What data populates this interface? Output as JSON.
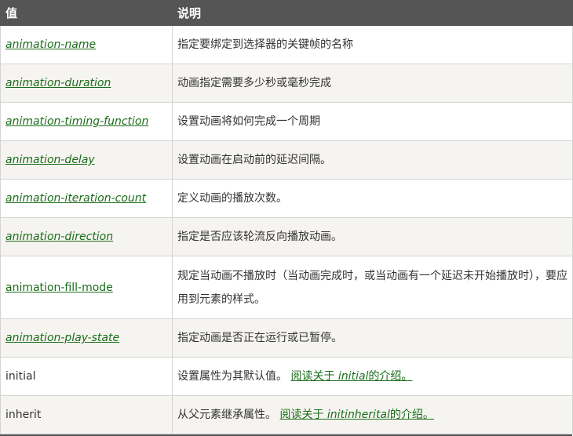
{
  "table": {
    "headers": [
      "值",
      "说明"
    ],
    "rows": [
      {
        "value": "animation-name",
        "link": true,
        "desc": "指定要绑定到选择器的关键帧的名称"
      },
      {
        "value": "animation-duration",
        "link": true,
        "desc": "动画指定需要多少秒或毫秒完成"
      },
      {
        "value": "animation-timing-function",
        "link": true,
        "desc": "设置动画将如何完成一个周期"
      },
      {
        "value": "animation-delay",
        "link": true,
        "desc": "设置动画在启动前的延迟间隔。"
      },
      {
        "value": "animation-iteration-count",
        "link": true,
        "desc": "定义动画的播放次数。"
      },
      {
        "value": "animation-direction",
        "link": true,
        "desc": "指定是否应该轮流反向播放动画。"
      },
      {
        "value": "animation-fill-mode",
        "link": true,
        "desc": "规定当动画不播放时（当动画完成时，或当动画有一个延迟未开始播放时），要应用到元素的样式。"
      },
      {
        "value": "animation-play-state",
        "link": true,
        "desc": "指定动画是否正在运行或已暂停。"
      },
      {
        "value": "initial",
        "link": false,
        "desc": "设置属性为其默认值。",
        "more_prefix": "阅读关于 ",
        "more_term": "initial",
        "more_suffix": "的介绍。"
      },
      {
        "value": "inherit",
        "link": false,
        "desc": "从父元素继承属性。",
        "more_prefix": "阅读关于 ",
        "more_term": "initinherital",
        "more_suffix": "的介绍。"
      }
    ]
  }
}
